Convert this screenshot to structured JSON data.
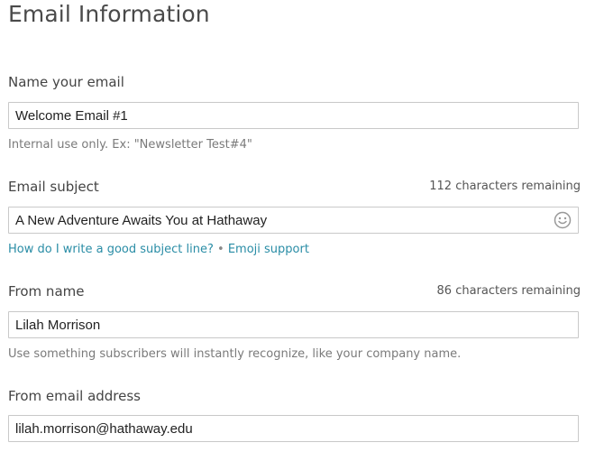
{
  "page": {
    "title": "Email Information"
  },
  "name_field": {
    "label": "Name your email",
    "value": "Welcome Email #1",
    "help": "Internal use only. Ex: \"Newsletter Test#4\""
  },
  "subject_field": {
    "label": "Email subject",
    "counter": "112 characters remaining",
    "value": "A New Adventure Awaits You at Hathaway",
    "emoji_icon": "smiley-face-icon",
    "link_subject": "How do I write a good subject line?",
    "separator": "•",
    "link_emoji": "Emoji support"
  },
  "from_name_field": {
    "label": "From name",
    "counter": "86 characters remaining",
    "value": "Lilah Morrison",
    "help": "Use something subscribers will instantly recognize, like your company name."
  },
  "from_email_field": {
    "label": "From email address",
    "value": "lilah.morrison@hathaway.edu"
  },
  "colors": {
    "link": "#2a8da6",
    "border": "#c9c9c9",
    "text": "#444444"
  }
}
